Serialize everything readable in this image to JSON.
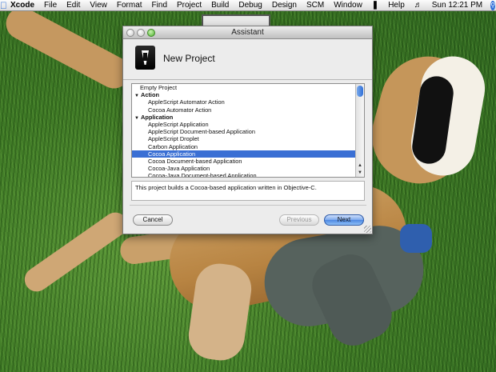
{
  "menubar": {
    "app_name": "Xcode",
    "items": [
      "File",
      "Edit",
      "View",
      "Format",
      "Find",
      "Project",
      "Build",
      "Debug",
      "Design",
      "SCM",
      "Window",
      "Help"
    ],
    "clock": "Sun 12:21 PM"
  },
  "window": {
    "title": "Assistant",
    "header_title": "New Project",
    "template_list": [
      {
        "label": "Empty Project",
        "kind": "item",
        "level": 0
      },
      {
        "label": "Action",
        "kind": "group",
        "expanded": true
      },
      {
        "label": "AppleScript Automator Action",
        "kind": "item",
        "level": 1
      },
      {
        "label": "Cocoa Automator Action",
        "kind": "item",
        "level": 1
      },
      {
        "label": "Application",
        "kind": "group",
        "expanded": true
      },
      {
        "label": "AppleScript Application",
        "kind": "item",
        "level": 1
      },
      {
        "label": "AppleScript Document-based Application",
        "kind": "item",
        "level": 1
      },
      {
        "label": "AppleScript Droplet",
        "kind": "item",
        "level": 1
      },
      {
        "label": "Carbon Application",
        "kind": "item",
        "level": 1
      },
      {
        "label": "Cocoa Application",
        "kind": "item",
        "level": 1,
        "selected": true
      },
      {
        "label": "Cocoa Document-based Application",
        "kind": "item",
        "level": 1
      },
      {
        "label": "Cocoa-Java Application",
        "kind": "item",
        "level": 1
      },
      {
        "label": "Cocoa-Java Document-based Application",
        "kind": "item",
        "level": 1
      }
    ],
    "description": "This project builds a Cocoa-based application written in Objective-C.",
    "buttons": {
      "cancel": "Cancel",
      "previous": "Previous",
      "next": "Next"
    }
  },
  "colors": {
    "selection": "#3a6fd4",
    "accent": "#2f6fd8"
  }
}
